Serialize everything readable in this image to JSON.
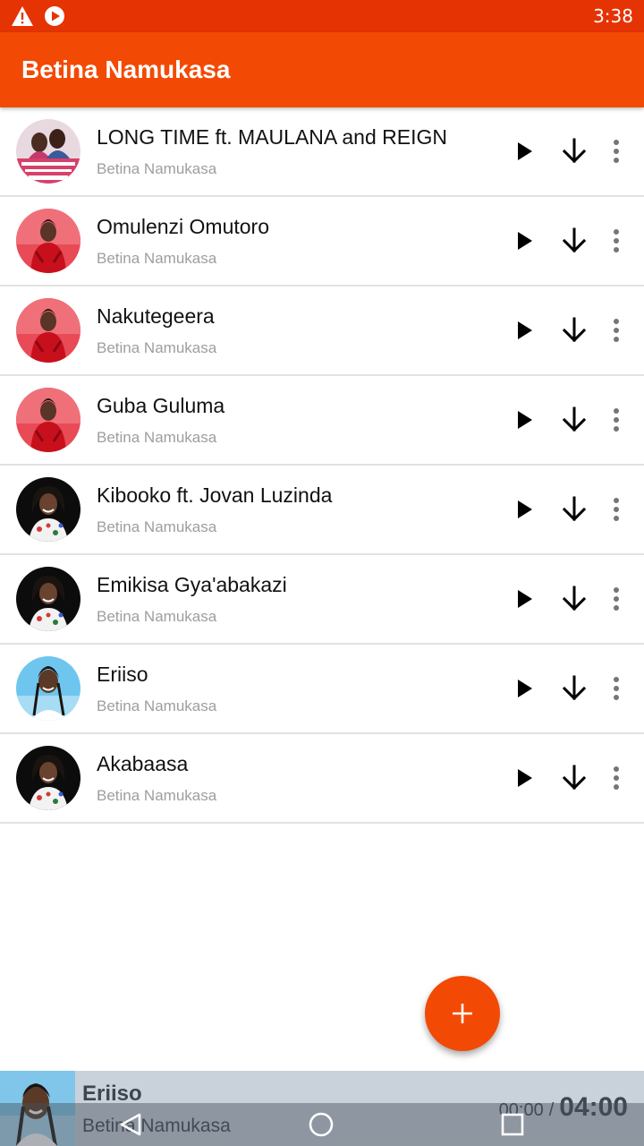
{
  "status_bar": {
    "time": "3:38",
    "icons": [
      "warning-icon",
      "play-circle-icon"
    ]
  },
  "app_bar": {
    "title": "Betina Namukasa"
  },
  "songs": [
    {
      "title": "LONG TIME ft. MAULANA and REIGN",
      "artist": "Betina Namukasa",
      "art": "poster"
    },
    {
      "title": "Omulenzi Omutoro",
      "artist": "Betina Namukasa",
      "art": "red"
    },
    {
      "title": "Nakutegeera",
      "artist": "Betina Namukasa",
      "art": "red"
    },
    {
      "title": "Guba Guluma",
      "artist": "Betina Namukasa",
      "art": "red"
    },
    {
      "title": "Kibooko ft. Jovan Luzinda",
      "artist": "Betina Namukasa",
      "art": "dark"
    },
    {
      "title": "Emikisa Gya'abakazi",
      "artist": "Betina Namukasa",
      "art": "dark"
    },
    {
      "title": "Eriiso",
      "artist": "Betina Namukasa",
      "art": "blue"
    },
    {
      "title": "Akabaasa",
      "artist": "Betina Namukasa",
      "art": "dark"
    }
  ],
  "row_icons": {
    "play": "play-icon",
    "download": "download-arrow-icon",
    "more": "more-vert-icon"
  },
  "fab": {
    "icon": "plus-icon"
  },
  "mini_player": {
    "title": "Eriiso",
    "artist": "Betina Namukasa",
    "elapsed": "00:00",
    "separator": "/",
    "total": "04:00"
  },
  "nav_bar": {
    "icons": [
      "back-icon",
      "home-icon",
      "recents-icon"
    ]
  },
  "colors": {
    "status_bar": "#e53304",
    "app_bar": "#f24a05",
    "accent": "#f24a05",
    "mini_player_bg": "#c9d1da",
    "secondary_text": "#9e9e9e"
  }
}
